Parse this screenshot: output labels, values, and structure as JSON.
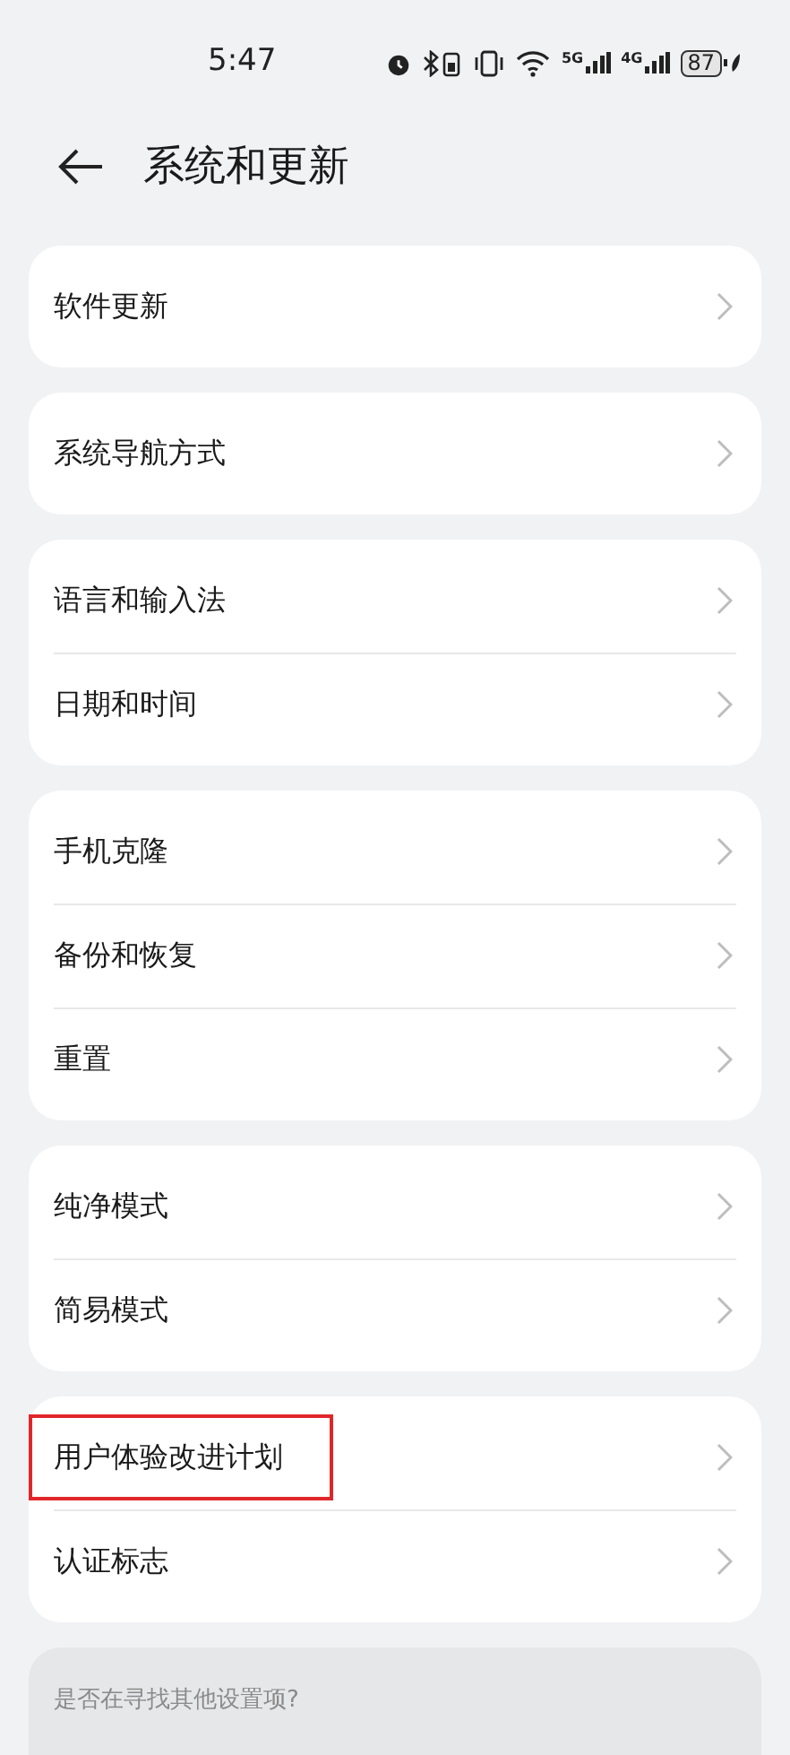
{
  "status_bar": {
    "time": "5:47",
    "networks": [
      "5G",
      "4G"
    ],
    "battery": "87"
  },
  "header": {
    "title": "系统和更新"
  },
  "groups": [
    {
      "items": [
        {
          "label": "软件更新",
          "highlighted": false
        }
      ]
    },
    {
      "items": [
        {
          "label": "系统导航方式",
          "highlighted": false
        }
      ]
    },
    {
      "items": [
        {
          "label": "语言和输入法",
          "highlighted": false
        },
        {
          "label": "日期和时间",
          "highlighted": false
        }
      ]
    },
    {
      "items": [
        {
          "label": "手机克隆",
          "highlighted": false
        },
        {
          "label": "备份和恢复",
          "highlighted": false
        },
        {
          "label": "重置",
          "highlighted": false
        }
      ]
    },
    {
      "items": [
        {
          "label": "纯净模式",
          "highlighted": false
        },
        {
          "label": "简易模式",
          "highlighted": false
        }
      ]
    },
    {
      "items": [
        {
          "label": "用户体验改进计划",
          "highlighted": true
        },
        {
          "label": "认证标志",
          "highlighted": false
        }
      ]
    }
  ],
  "suggestion": {
    "text": "是否在寻找其他设置项?"
  }
}
